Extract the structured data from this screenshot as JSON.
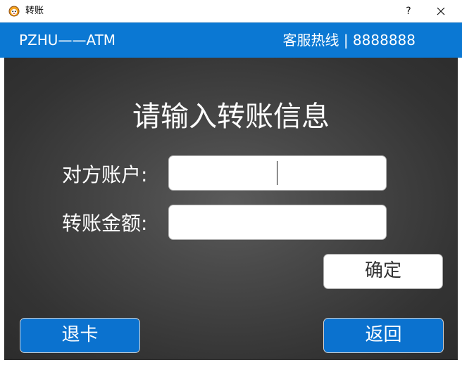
{
  "window": {
    "title": "转账",
    "help_label": "?"
  },
  "header": {
    "brand": "PZHU——ATM",
    "hotline": "客服热线 | 8888888"
  },
  "main": {
    "title": "请输入转账信息",
    "account_label": "对方账户:",
    "account_value": "",
    "amount_label": "转账金额:",
    "amount_value": "",
    "confirm_label": "确定",
    "exit_card_label": "退卡",
    "back_label": "返回"
  },
  "colors": {
    "header_bg": "#0b78d3",
    "button_blue": "#0b72cf",
    "panel_dark": "#3a3a3a"
  }
}
